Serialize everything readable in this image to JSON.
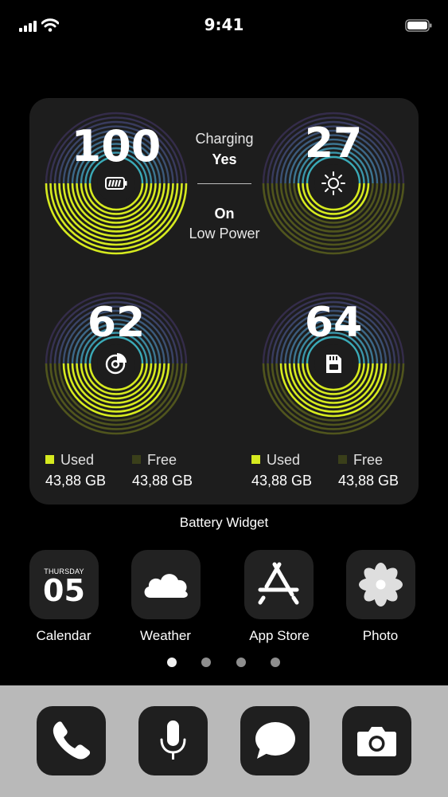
{
  "status_bar": {
    "time": "9:41"
  },
  "widget": {
    "caption": "Battery Widget",
    "gauges": [
      {
        "name": "battery",
        "value": "100",
        "level": 1.0,
        "icon": "battery-icon"
      },
      {
        "name": "brightness",
        "value": "27",
        "level": 0.27,
        "icon": "sun-icon"
      },
      {
        "name": "storage",
        "value": "62",
        "level": 0.62,
        "icon": "pie-chart-icon"
      },
      {
        "name": "sd-card",
        "value": "64",
        "level": 0.64,
        "icon": "sd-card-icon"
      }
    ],
    "info": {
      "charging_label": "Charging",
      "charging_value": "Yes",
      "power_state": "On",
      "power_label": "Low Power"
    },
    "legend_left": {
      "used_label": "Used",
      "used_value": "43,88 GB",
      "free_label": "Free",
      "free_value": "43,88 GB"
    },
    "legend_right": {
      "used_label": "Used",
      "used_value": "43,88 GB",
      "free_label": "Free",
      "free_value": "43,88 GB"
    }
  },
  "apps": [
    {
      "label": "Calendar",
      "icon": "calendar-icon",
      "day": "THURSDAY",
      "date": "05"
    },
    {
      "label": "Weather",
      "icon": "cloud-icon"
    },
    {
      "label": "App Store",
      "icon": "app-store-icon"
    },
    {
      "label": "Photo",
      "icon": "flower-icon"
    }
  ],
  "page_indicator": {
    "pages": 4,
    "current": 1
  },
  "dock": [
    {
      "icon": "phone-icon"
    },
    {
      "icon": "microphone-icon"
    },
    {
      "icon": "message-icon"
    },
    {
      "icon": "camera-icon"
    }
  ],
  "colors": {
    "accent_green": "#d6ea1f",
    "ring_cyan": "#3fc4d4",
    "ring_purple": "#6a4fb3",
    "widget_bg": "#1d1d1d",
    "dock_bg": "#b9b9b9"
  }
}
